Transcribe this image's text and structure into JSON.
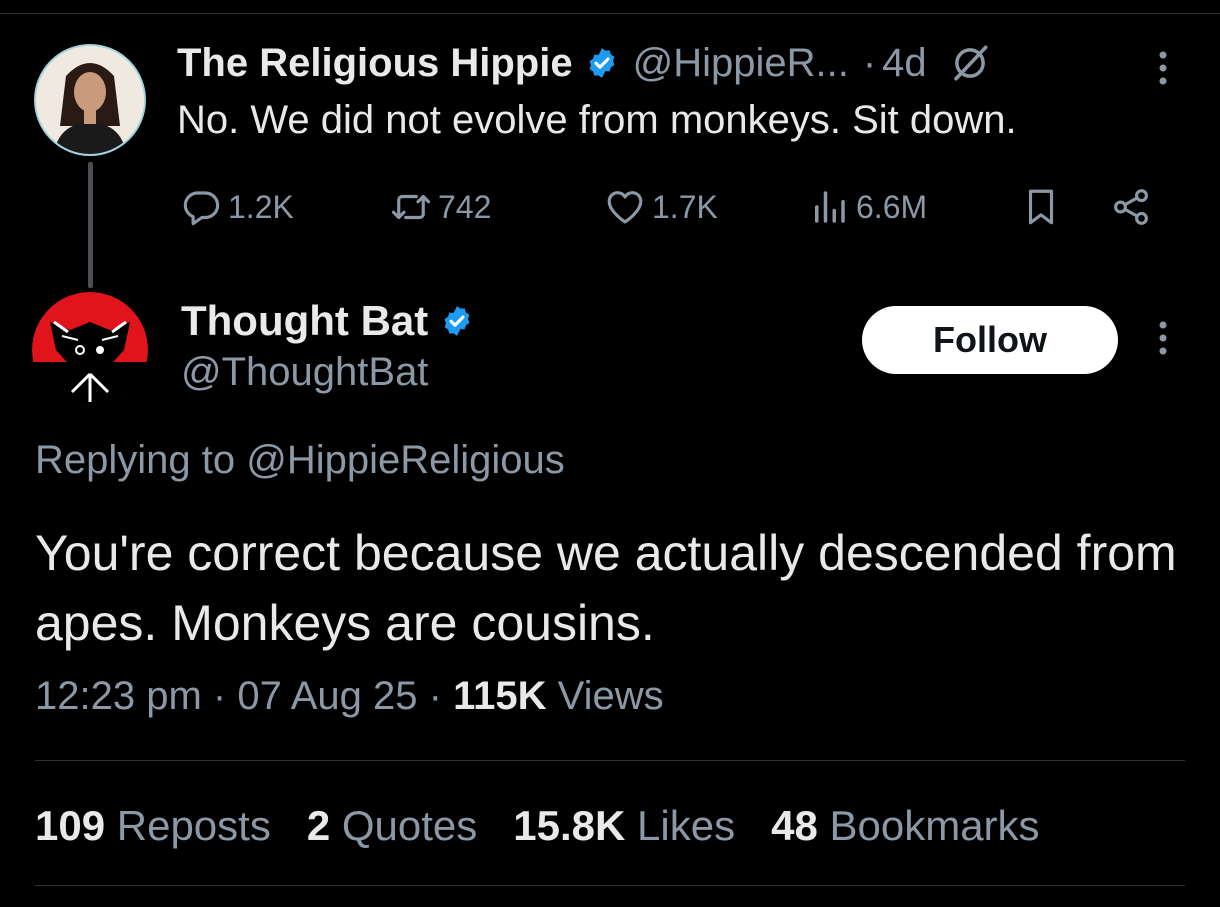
{
  "parent_tweet": {
    "author_name": "The Religious Hippie",
    "handle": "@HippieR...",
    "separator": "·",
    "time_ago": "4d",
    "text": "No. We did not evolve from monkeys. Sit down.",
    "actions": {
      "replies": "1.2K",
      "reposts": "742",
      "likes": "1.7K",
      "views": "6.6M"
    }
  },
  "main_tweet": {
    "author_name": "Thought Bat",
    "handle": "@ThoughtBat",
    "follow_label": "Follow",
    "replying_to": "Replying to @HippieReligious",
    "text": "You're correct because we actually descended from apes. Monkeys are cousins.",
    "time": "12:23 pm",
    "date": "07 Aug 25",
    "views_count": "115K",
    "views_label": "Views",
    "stats": {
      "reposts_count": "109",
      "reposts_label": "Reposts",
      "quotes_count": "2",
      "quotes_label": "Quotes",
      "likes_count": "15.8K",
      "likes_label": "Likes",
      "bookmarks_count": "48",
      "bookmarks_label": "Bookmarks"
    }
  },
  "colors": {
    "background": "#000000",
    "text_primary": "#e7e9ea",
    "text_secondary": "#8b98a5",
    "verified_blue": "#1d9bf0",
    "avatar_red": "#e1141b"
  }
}
